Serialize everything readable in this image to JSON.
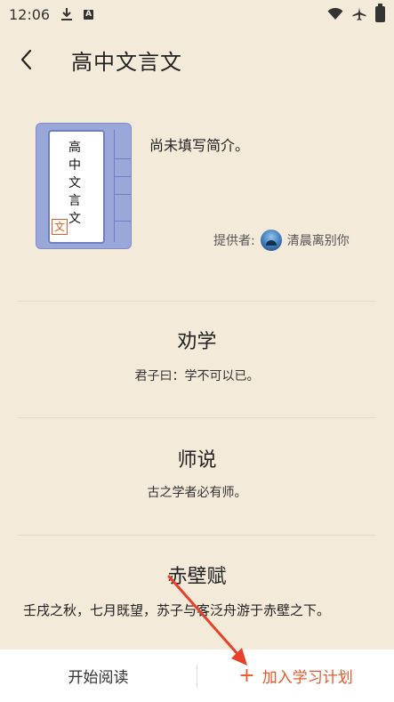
{
  "status_bar": {
    "time": "12:06",
    "icons": [
      "download-icon",
      "a-badge-icon",
      "wifi-icon",
      "airplane-icon",
      "battery-icon"
    ],
    "badge_letter": "A"
  },
  "header": {
    "title": "高中文言文"
  },
  "book": {
    "cover_title_chars": [
      "高",
      "中",
      "文",
      "言",
      "文"
    ],
    "seal_char": "文",
    "intro": "尚未填写简介。",
    "provider_label": "提供者:",
    "provider_name": "清晨离别你"
  },
  "lessons": [
    {
      "title": "劝学",
      "quote": "君子曰：学不可以已。"
    },
    {
      "title": "师说",
      "quote": "古之学者必有师。"
    },
    {
      "title": "赤壁赋",
      "quote": "壬戌之秋，七月既望，苏子与客泛舟游于赤壁之下。"
    }
  ],
  "bottom_bar": {
    "start_reading": "开始阅读",
    "add_plan": "加入学习计划",
    "plus": "+"
  },
  "colors": {
    "background": "#f4ead9",
    "accent": "#e9582c",
    "book_blue": "#9aa7d9",
    "annotation_arrow": "#e8402a"
  }
}
